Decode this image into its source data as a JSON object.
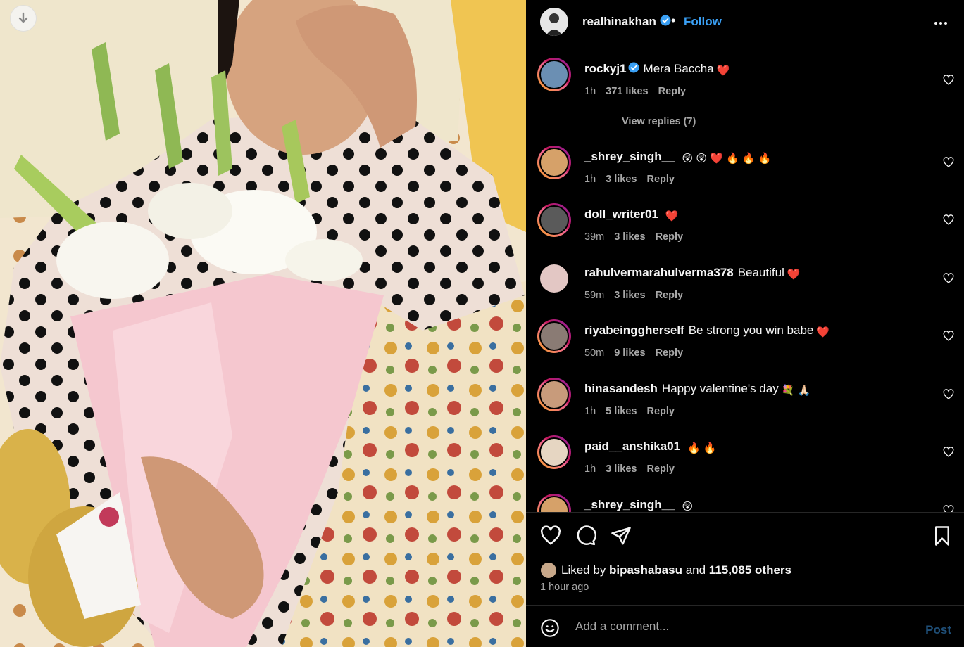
{
  "post": {
    "author": "realhinakhan",
    "follow_label": "Follow",
    "dot": "•"
  },
  "comments": [
    {
      "user": "rockyj1",
      "verified": true,
      "text": "Mera Baccha",
      "emojis": "❤️",
      "time": "1h",
      "likes": "371 likes",
      "reply": "Reply",
      "avatar_color": "#6b8fb3"
    },
    {
      "user": "_shrey_singh__",
      "verified": false,
      "text": "",
      "emojis": "😲 😲 ❤️ 🔥 🔥 🔥",
      "time": "1h",
      "likes": "3 likes",
      "reply": "Reply",
      "avatar_color": "#d6a169"
    },
    {
      "user": "doll_writer01",
      "verified": false,
      "text": "",
      "emojis": "❤️",
      "time": "39m",
      "likes": "3 likes",
      "reply": "Reply",
      "avatar_color": "#5a5a5a"
    },
    {
      "user": "rahulvermarahulverma378",
      "verified": false,
      "text": "Beautiful",
      "emojis": "❤️",
      "time": "59m",
      "likes": "3 likes",
      "reply": "Reply",
      "avatar_color": "#e3c7c4"
    },
    {
      "user": "riyabeinggherself",
      "verified": false,
      "text": "Be strong you win babe",
      "emojis": "❤️",
      "time": "50m",
      "likes": "9 likes",
      "reply": "Reply",
      "avatar_color": "#8a7b74"
    },
    {
      "user": "hinasandesh",
      "verified": false,
      "text": "Happy valentine's day",
      "emojis": "💐 🙏🏻",
      "time": "1h",
      "likes": "5 likes",
      "reply": "Reply",
      "avatar_color": "#c89b7b"
    },
    {
      "user": "paid__anshika01",
      "verified": false,
      "text": "",
      "emojis": "🔥 🔥",
      "time": "1h",
      "likes": "3 likes",
      "reply": "Reply",
      "avatar_color": "#e6d6c2"
    },
    {
      "user": "_shrey_singh__",
      "verified": false,
      "text": "",
      "emojis": "😲",
      "time": "",
      "likes": "",
      "reply": "",
      "avatar_color": "#d6a169"
    }
  ],
  "view_replies": "View replies (7)",
  "likes_summary": {
    "prefix": "Liked by ",
    "liker": "bipashabasu",
    "middle": " and ",
    "count": "115,085 others"
  },
  "timestamp": "1 hour ago",
  "add_comment": {
    "placeholder": "Add a comment...",
    "post_label": "Post"
  },
  "icons": {
    "download": "arrow-down-icon",
    "verified": "verified-badge-icon",
    "more": "more-horizontal-icon",
    "like": "heart-icon",
    "comment": "comment-bubble-icon",
    "share": "paper-plane-icon",
    "save": "bookmark-icon",
    "emoji": "smiley-icon"
  },
  "colors": {
    "accent": "#0095f6",
    "background": "#000000",
    "muted": "#a8a8a8"
  }
}
